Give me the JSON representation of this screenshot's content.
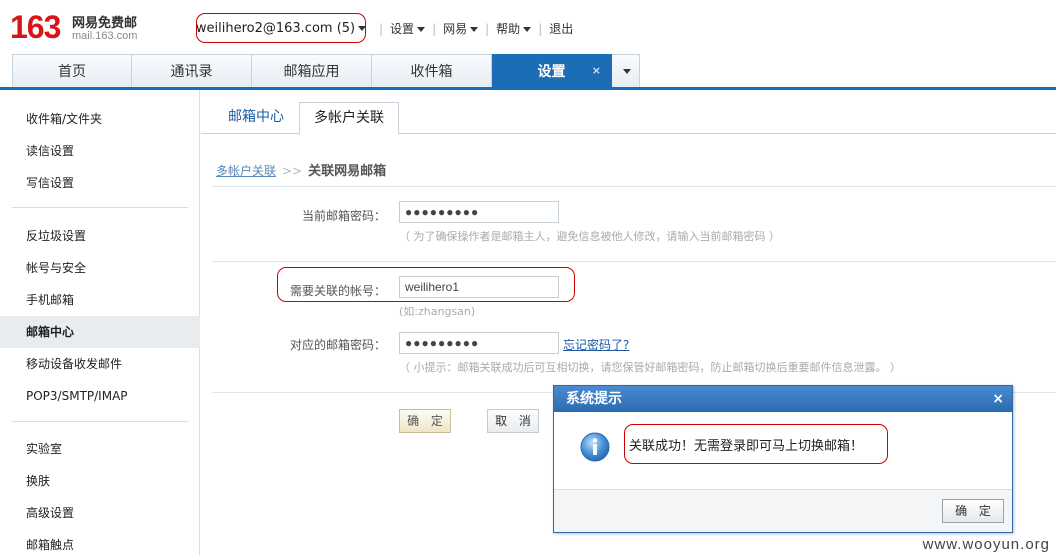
{
  "logo": {
    "number": "163",
    "name_cn": "网易免费邮",
    "domain": "mail.163.com"
  },
  "account": {
    "label": "weilihero2@163.com (5)"
  },
  "topnav": {
    "settings": "设置",
    "netease": "网易",
    "help": "帮助",
    "logout": "退出"
  },
  "main_tabs": {
    "home": "首页",
    "contacts": "通讯录",
    "apps": "邮箱应用",
    "inbox": "收件箱",
    "settings": "设置",
    "close": "×"
  },
  "sidebar": {
    "items": [
      "收件箱/文件夹",
      "读信设置",
      "写信设置",
      "反垃圾设置",
      "帐号与安全",
      "手机邮箱",
      "邮箱中心",
      "移动设备收发邮件",
      "POP3/SMTP/IMAP",
      "实验室",
      "换肤",
      "高级设置",
      "邮箱触点"
    ],
    "active_index": 6
  },
  "sub_tabs": {
    "mail_center": "邮箱中心",
    "multi_account": "多帐户关联"
  },
  "breadcrumb": {
    "link": "多帐户关联",
    "separator": ">>",
    "current": "关联网易邮箱"
  },
  "form": {
    "current_password": {
      "label": "当前邮箱密码：",
      "value": "●●●●●●●●●",
      "hint": "（ 为了确保操作者是邮箱主人，避免信息被他人修改，请输入当前邮箱密码 ）"
    },
    "link_account": {
      "label": "需要关联的帐号：",
      "value": "weilihero1",
      "example": "(如:zhangsan)"
    },
    "link_password": {
      "label": "对应的邮箱密码：",
      "value": "●●●●●●●●●",
      "forgot": "忘记密码了?",
      "hint": "（ 小提示：邮箱关联成功后可互相切换，请您保管好邮箱密码，防止邮箱切换后重要邮件信息泄露。 ）"
    },
    "ok": "确 定",
    "cancel": "取 消"
  },
  "dialog": {
    "title": "系统提示",
    "close": "×",
    "message": "关联成功！无需登录即可马上切换邮箱！",
    "ok": "确 定",
    "icon": "info-icon"
  },
  "watermark": "www.wooyun.org",
  "colors": {
    "brand_red": "#d71518",
    "tab_blue": "#1c6db6",
    "highlight_red": "#cc0000"
  }
}
